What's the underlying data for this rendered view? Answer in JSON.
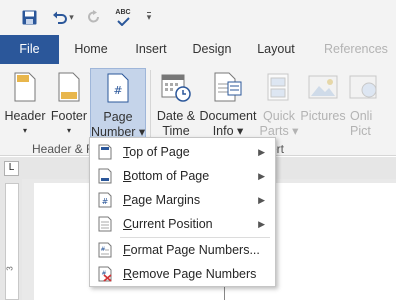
{
  "qat": {
    "undo_arrow": "▾",
    "customize_arrow": "▾",
    "spellcheck_label": "ABC"
  },
  "tabs": [
    {
      "label": "File",
      "state": "file"
    },
    {
      "label": "Home",
      "state": "normal"
    },
    {
      "label": "Insert",
      "state": "normal"
    },
    {
      "label": "Design",
      "state": "normal"
    },
    {
      "label": "Layout",
      "state": "normal"
    },
    {
      "label": "References",
      "state": "clipped"
    }
  ],
  "ribbon": {
    "buttons": [
      {
        "line1": "Header",
        "line2": "▾",
        "icon": "header-icon"
      },
      {
        "line1": "Footer",
        "line2": "▾",
        "icon": "footer-icon"
      },
      {
        "line1": "Page",
        "line2": "Number ▾",
        "icon": "page-number-icon",
        "active": true
      },
      {
        "line1": "Date &",
        "line2": "Time",
        "icon": "calendar-icon"
      },
      {
        "line1": "Document",
        "line2": "Info ▾",
        "icon": "document-info-icon"
      },
      {
        "line1": "Quick",
        "line2": "Parts ▾",
        "icon": "quick-parts-icon",
        "disabled": true
      },
      {
        "line1": "Pictures",
        "line2": "",
        "icon": "pictures-icon",
        "disabled": true
      },
      {
        "line1": "Onli",
        "line2": "Pict",
        "icon": "online-pictures-icon",
        "disabled": true
      }
    ],
    "group_header_footer": "Header & F",
    "group_insert": "ert"
  },
  "ruler": {
    "tab_selector": "L",
    "vertical_tick": "3"
  },
  "page_number_menu": {
    "items": [
      {
        "label": "Top of Page",
        "accel": "T",
        "rest": "op of Page",
        "submenu": true,
        "icon": "top-of-page-icon"
      },
      {
        "label": "Bottom of Page",
        "accel": "B",
        "rest": "ottom of Page",
        "submenu": true,
        "icon": "bottom-of-page-icon"
      },
      {
        "label": "Page Margins",
        "accel": "P",
        "rest": "age Margins",
        "submenu": true,
        "icon": "page-margins-icon"
      },
      {
        "label": "Current Position",
        "accel": "C",
        "rest": "urrent Position",
        "submenu": true,
        "icon": "current-position-icon"
      },
      {
        "label": "Format Page Numbers...",
        "accel": "F",
        "rest": "ormat Page Numbers...",
        "submenu": false,
        "icon": "format-page-numbers-icon"
      },
      {
        "label": "Remove Page Numbers",
        "accel": "R",
        "rest": "emove Page Numbers",
        "submenu": false,
        "icon": "remove-page-numbers-icon"
      }
    ],
    "submenu_arrow": "▶"
  },
  "colors": {
    "file_tab": "#2b579a",
    "active_button": "#c5d4ea",
    "save_icon": "#2b579a",
    "remove_x": "#d13438"
  }
}
